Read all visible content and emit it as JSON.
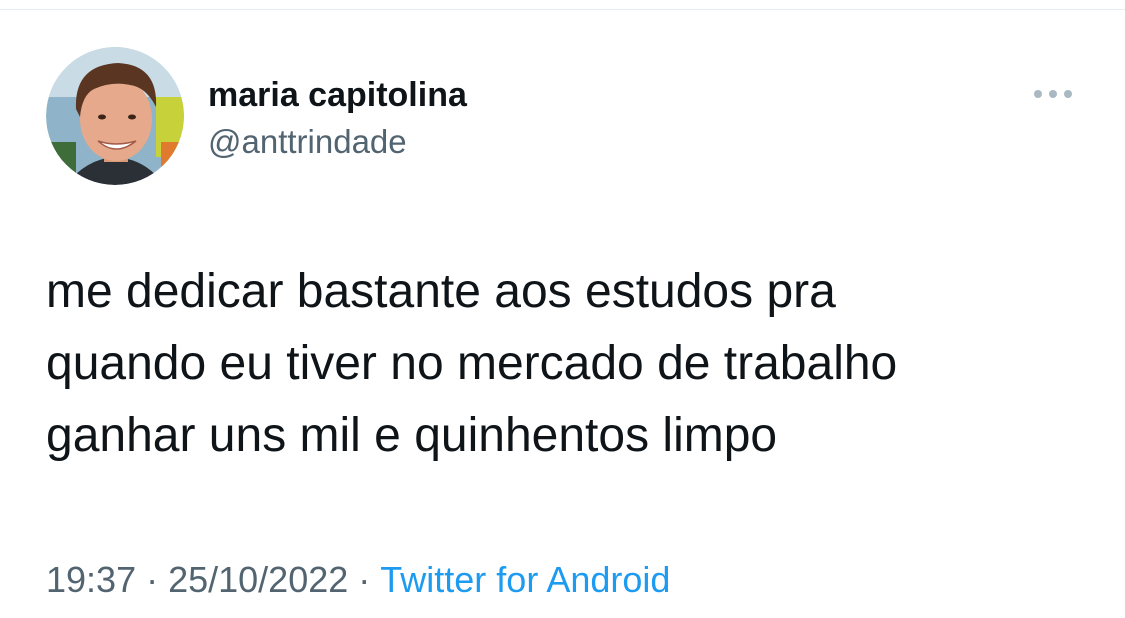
{
  "tweet": {
    "author": {
      "display_name": "maria capitolina",
      "handle": "@anttrindade",
      "avatar_icon": "profile-photo"
    },
    "more_icon": "more-horizontal-icon",
    "text": "me dedicar bastante aos estudos pra\nquando eu tiver no mercado de trabalho\nganhar uns mil e quinhentos limpo",
    "time": "19:37",
    "separator": "·",
    "date": "25/10/2022",
    "source": "Twitter for Android"
  },
  "colors": {
    "text_primary": "#0f1419",
    "text_secondary": "#536471",
    "link": "#1d9bf0",
    "background": "#ffffff"
  }
}
